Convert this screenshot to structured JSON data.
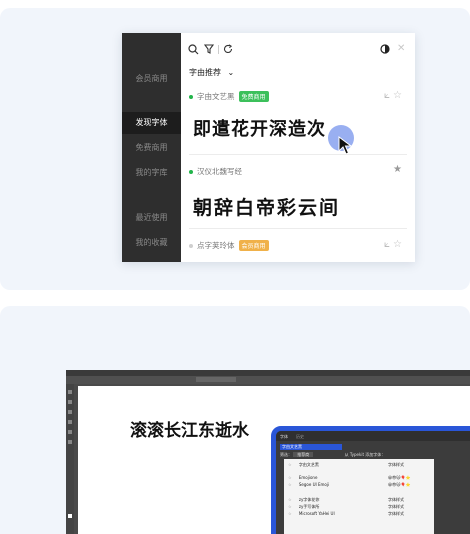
{
  "colors": {
    "card_bg": "#f1f5fb",
    "sidebar_bg": "#2e2e2e",
    "free_badge": "#3cc05b",
    "member_badge": "#f0b14a",
    "green_dot": "#22b44a",
    "frame_blue": "#2a56d8"
  },
  "sidebar": {
    "items": [
      {
        "label": "会员商用"
      },
      {
        "label": "发现字体"
      },
      {
        "label": "免费商用"
      },
      {
        "label": "我的字库"
      },
      {
        "label": "最近使用"
      },
      {
        "label": "我的收藏"
      }
    ]
  },
  "toolbar": {
    "icons": [
      "search-icon",
      "filter-icon",
      "refresh-icon",
      "theme-toggle-icon",
      "close-icon"
    ]
  },
  "filter": {
    "dropdown_label": "字由推荐",
    "chevron": "⌄"
  },
  "fonts": [
    {
      "name": "字由文艺黑",
      "badge": "免费商用",
      "sample": "即遣花开深造次"
    },
    {
      "name": "汉仪北魏写经",
      "badge": "",
      "sample": "朝辞白帝彩云间"
    },
    {
      "name": "点字荚玲体",
      "badge": "会员商用",
      "sample": ""
    }
  ],
  "editor": {
    "canvas_text": "滚滚长江东逝水",
    "panel": {
      "tab_labels": [
        "字体",
        "历史"
      ],
      "search_value": "字由文艺黑",
      "filter_label": "筛选：",
      "filter_value": "推荐商",
      "typekit_label": "从 Typekit 添加字体：",
      "list_header": [
        "字由文艺黑",
        "字体样式"
      ],
      "items": [
        {
          "name": "Emojione",
          "sample": "😀😎🐱🎈⭐"
        },
        {
          "name": "Segoe UI Emoji",
          "sample": "😀😎🐱🎈⭐"
        },
        {
          "name": "zy字体花你",
          "sample": "字体样式"
        },
        {
          "name": "zy手写体所",
          "sample": "字体样式"
        },
        {
          "name": "Microsoft YaHei UI",
          "sample": "字体样式"
        }
      ]
    }
  }
}
